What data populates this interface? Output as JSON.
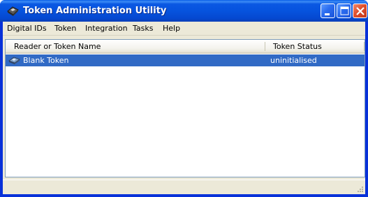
{
  "window": {
    "title": "Token Administration Utility",
    "icon": "token-app-icon"
  },
  "menu": {
    "items": [
      "Digital IDs",
      "Token",
      "Integration",
      "Tasks",
      "Help"
    ]
  },
  "list": {
    "columns": [
      "Reader or Token Name",
      "Token Status"
    ],
    "rows": [
      {
        "name": "Blank Token",
        "status": "uninitialised",
        "icon": "token-icon",
        "selected": true
      }
    ]
  },
  "status_bar": {
    "text": ""
  },
  "colors": {
    "title_bar": "#0653de",
    "selection": "#316ac5",
    "client_bg": "#ece9d8",
    "close_button": "#e0502e"
  }
}
